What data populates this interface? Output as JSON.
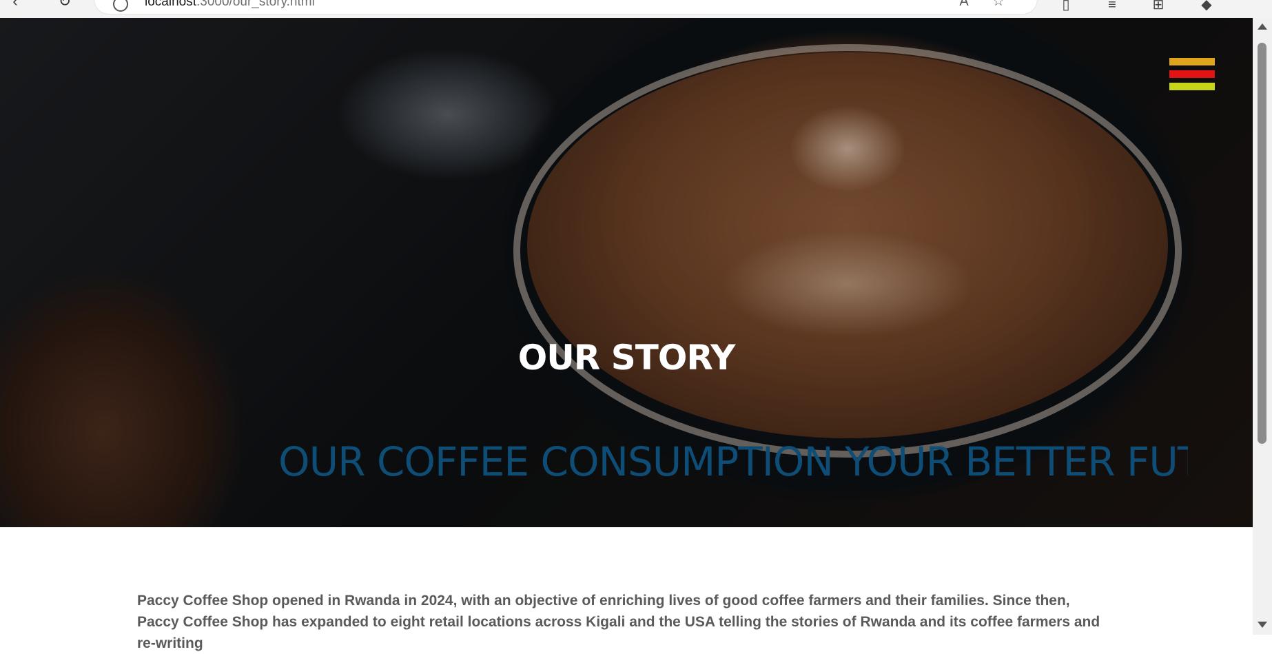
{
  "browser": {
    "url_host": "localhost",
    "url_rest": ":3000/our_story.html"
  },
  "hero": {
    "title": "OUR STORY",
    "subtitle": "OUR COFFEE CONSUMPTION YOUR BETTER FUT"
  },
  "menu": {
    "colors": [
      "#e0a51c",
      "#e41313",
      "#c8d61a"
    ]
  },
  "story": {
    "paragraph": "Paccy Coffee Shop opened in Rwanda in 2024, with an objective of enriching lives of good coffee farmers and their families. Since then, Paccy Coffee Shop has expanded to eight retail locations across Kigali and the USA telling the stories of Rwanda and its coffee farmers and re-writing"
  }
}
